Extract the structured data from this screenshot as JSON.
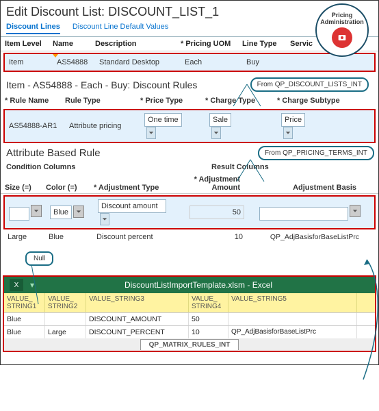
{
  "badge": {
    "line1": "Pricing",
    "line2": "Administration"
  },
  "page_title_prefix": "Edit Discount List: ",
  "page_title_name": "DISCOUNT_LIST_1",
  "tabs": [
    {
      "label": "Discount Lines",
      "active": true
    },
    {
      "label": "Discount Line Default Values",
      "active": false
    }
  ],
  "items_table": {
    "headers": {
      "item_level": "Item Level",
      "name": "Name",
      "description": "Description",
      "pricing_uom": "* Pricing UOM",
      "line_type": "Line Type",
      "service": "Servic"
    },
    "row": {
      "item_level": "Item",
      "name": "AS54888",
      "description": "Standard Desktop",
      "pricing_uom": "Each",
      "line_type": "Buy",
      "service": ""
    }
  },
  "annotation_items": "From QP_DISCOUNT_LISTS_INT",
  "rules_section_title": "Item - AS54888 - Each - Buy: Discount Rules",
  "rules_table": {
    "headers": {
      "rule_name": "* Rule Name",
      "rule_type": "Rule Type",
      "price_type": "* Price Type",
      "charge_type": "* Charge Type",
      "charge_subtype": "* Charge Subtype"
    },
    "row": {
      "rule_name": "AS54888-AR1",
      "rule_type": "Attribute pricing",
      "price_type": "One time",
      "charge_type": "Sale",
      "charge_subtype": "Price"
    }
  },
  "annotation_rules": "From QP_PRICING_TERMS_INT",
  "attr_rule_title": "Attribute Based Rule",
  "col_groups": {
    "cond": "Condition Columns",
    "result": "Result Columns"
  },
  "matrix_headers": {
    "size": "Size (=)",
    "color": "Color (=)",
    "adj_type": "* Adjustment Type",
    "adj_amount": "* Adjustment Amount",
    "adj_basis": "Adjustment Basis"
  },
  "matrix_rows": [
    {
      "size": "",
      "color": "Blue",
      "adj_type": "Discount amount",
      "adj_amount": "50",
      "adj_basis": "",
      "selected": true
    },
    {
      "size": "Large",
      "color": "Blue",
      "adj_type": "Discount percent",
      "adj_amount": "10",
      "adj_basis": "QP_AdjBasisforBaseListPrc",
      "selected": false
    }
  ],
  "null_label": "Null",
  "excel": {
    "title": "DiscountListImportTemplate.xlsm - Excel",
    "headers": [
      "VALUE_ STRING1",
      "VALUE_ STRING2",
      "VALUE_STRING3",
      "VALUE_ STRING4",
      "VALUE_STRING5"
    ],
    "rows": [
      {
        "c1": "Blue",
        "c2": "",
        "c3": "DISCOUNT_AMOUNT",
        "c4": "50",
        "c5": ""
      },
      {
        "c1": "Blue",
        "c2": "Large",
        "c3": "DISCOUNT_PERCENT",
        "c4": "10",
        "c5": "QP_AdjBasisforBaseListPrc"
      }
    ],
    "sheet_tab": "QP_MATRIX_RULES_INT"
  }
}
